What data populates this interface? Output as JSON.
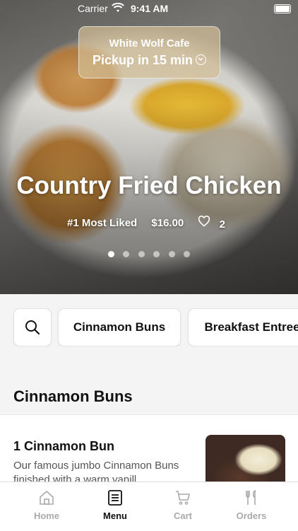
{
  "status_bar": {
    "carrier": "Carrier",
    "time": "9:41 AM"
  },
  "pickup": {
    "restaurant": "White Wolf Cafe",
    "pickup_time": "Pickup in 15 min"
  },
  "hero": {
    "title": "Country Fried Chicken",
    "badge": "#1 Most Liked",
    "price": "$16.00",
    "likes": "2",
    "carousel": {
      "count": 6,
      "active_index": 0
    }
  },
  "categories": {
    "search_icon": "search-icon",
    "items": [
      "Cinnamon Buns",
      "Breakfast Entree"
    ]
  },
  "section": {
    "title": "Cinnamon Buns"
  },
  "menu_items": [
    {
      "name": "1 Cinnamon Bun",
      "description": "Our famous jumbo Cinnamon Buns finished with a warm vanill..."
    }
  ],
  "tab_bar": {
    "tabs": [
      {
        "label": "Home",
        "icon": "home-icon",
        "active": false
      },
      {
        "label": "Menu",
        "icon": "menu-icon",
        "active": true
      },
      {
        "label": "Cart",
        "icon": "cart-icon",
        "active": false
      },
      {
        "label": "Orders",
        "icon": "fork-knife-icon",
        "active": false
      }
    ]
  },
  "colors": {
    "active_tab": "#111111",
    "inactive_tab": "#aaaaaa",
    "background": "#f4f4f4"
  }
}
